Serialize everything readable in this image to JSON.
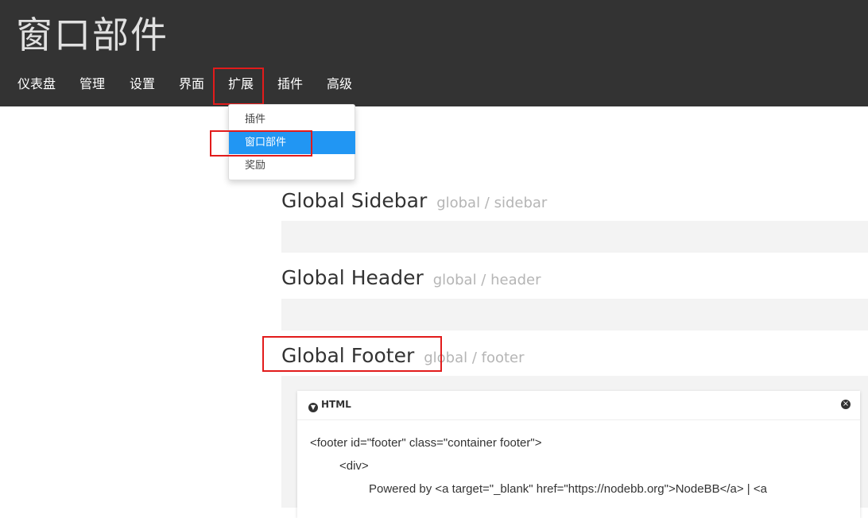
{
  "header": {
    "title": "窗口部件",
    "nav": [
      "仪表盘",
      "管理",
      "设置",
      "界面",
      "扩展",
      "插件",
      "高级"
    ]
  },
  "dropdown": {
    "items": [
      "插件",
      "窗口部件",
      "奖励"
    ]
  },
  "areas": [
    {
      "title": "Global Sidebar",
      "sub": "global / sidebar"
    },
    {
      "title": "Global Header",
      "sub": "global / header"
    },
    {
      "title": "Global Footer",
      "sub": "global / footer"
    }
  ],
  "widget": {
    "label": "HTML",
    "code": [
      "<footer id=\"footer\" class=\"container footer\">",
      "<div>",
      "Powered by <a target=\"_blank\" href=\"https://nodebb.org\">NodeBB</a> | <a"
    ]
  }
}
